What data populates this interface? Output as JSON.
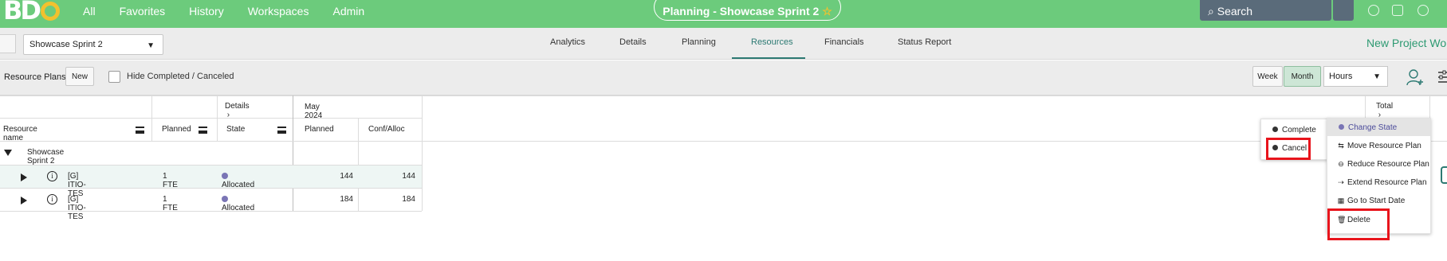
{
  "topbar": {
    "logo_text": "BD",
    "nav": [
      "All",
      "Favorites",
      "History",
      "Workspaces",
      "Admin"
    ],
    "center_title": "Planning - Showcase Sprint 2",
    "search_placeholder": "Search"
  },
  "subbar": {
    "project_select": "Showcase Sprint 2",
    "tabs": [
      "Analytics",
      "Details",
      "Planning",
      "Resources",
      "Financials",
      "Status Report"
    ],
    "active_tab": "Resources",
    "new_project_link": "New Project Wor"
  },
  "toolbar": {
    "label": "Resource Plans",
    "new_button": "New",
    "hide_label": "Hide Completed / Canceled",
    "week": "Week",
    "month": "Month",
    "units": "Hours"
  },
  "grid": {
    "details_header": "Details",
    "period_header": "May 2024",
    "total_header": "Total",
    "columns": [
      "Resource name",
      "Planned",
      "State",
      "Planned",
      "Conf/Alloc"
    ],
    "group_row": "Showcase Sprint 2",
    "rows": [
      {
        "name": "[G] ITIO-TES",
        "planned": "1 FTE",
        "state": "Allocated",
        "period_planned": "144",
        "conf_alloc": "144"
      },
      {
        "name": "[G] ITIO-TES",
        "planned": "1 FTE",
        "state": "Allocated",
        "period_planned": "184",
        "conf_alloc": "184"
      }
    ]
  },
  "state_submenu": {
    "items": [
      "Complete",
      "Cancel"
    ]
  },
  "context_menu": {
    "items": [
      "Change State",
      "Move Resource Plan",
      "Reduce Resource Plan",
      "Extend Resource Plan",
      "Go to Start Date",
      "Delete"
    ]
  },
  "colors": {
    "topbar": "#6ccb7c",
    "accent": "#2d7a73",
    "state_dot": "#7a75b5",
    "highlight_box": "#e8141c"
  }
}
